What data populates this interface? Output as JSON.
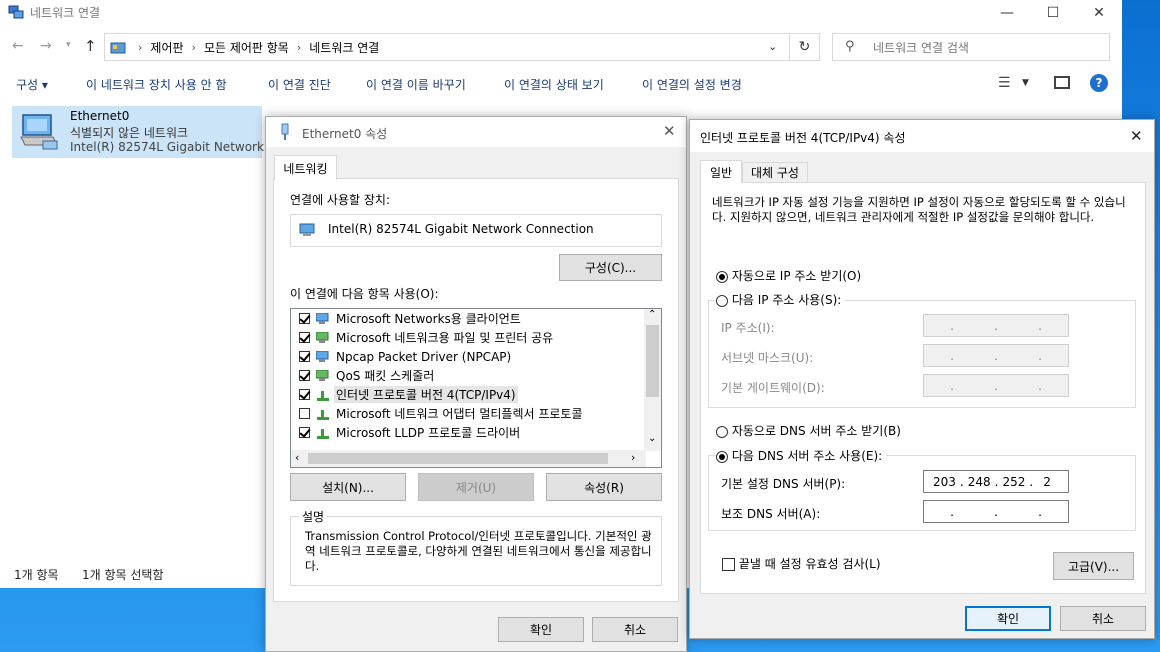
{
  "explorer": {
    "title": "네트워크 연결",
    "breadcrumb": [
      "제어판",
      "모든 제어판 항목",
      "네트워크 연결"
    ],
    "search_placeholder": "네트워크 연결 검색",
    "commands": [
      "구성 ▾",
      "이 네트워크 장치 사용 안 함",
      "이 연결 진단",
      "이 연결 이름 바꾸기",
      "이 연결의 상태 보기",
      "이 연결의 설정 변경"
    ],
    "item": {
      "name": "Ethernet0",
      "status": "식별되지 않은 네트워크",
      "device": "Intel(R) 82574L Gigabit Network ..."
    },
    "status_count": "1개 항목",
    "status_selected": "1개 항목 선택함"
  },
  "eth_dialog": {
    "title": "Ethernet0 속성",
    "tab": "네트워킹",
    "connect_using_label": "연결에 사용할 장치:",
    "device_name": "Intel(R) 82574L Gigabit Network Connection",
    "configure_button": "구성(C)...",
    "items_label": "이 연결에 다음 항목 사용(O):",
    "items": [
      {
        "label": "Microsoft Networks용 클라이언트",
        "checked": true,
        "icon": "network-client-icon"
      },
      {
        "label": "Microsoft 네트워크용 파일 및 프린터 공유",
        "checked": true,
        "icon": "network-service-icon"
      },
      {
        "label": "Npcap Packet Driver (NPCAP)",
        "checked": true,
        "icon": "network-client-icon"
      },
      {
        "label": "QoS 패킷 스케줄러",
        "checked": true,
        "icon": "network-service-icon"
      },
      {
        "label": "인터넷 프로토콜 버전 4(TCP/IPv4)",
        "checked": true,
        "icon": "protocol-icon",
        "selected": true
      },
      {
        "label": "Microsoft 네트워크 어댑터 멀티플렉서 프로토콜",
        "checked": false,
        "icon": "protocol-icon"
      },
      {
        "label": "Microsoft LLDP 프로토콜 드라이버",
        "checked": true,
        "icon": "protocol-icon"
      }
    ],
    "install_button": "설치(N)...",
    "uninstall_button": "제거(U)",
    "properties_button": "속성(R)",
    "description_title": "설명",
    "description": "Transmission Control Protocol/인터넷 프로토콜입니다. 기본적인 광역 네트워크 프로토콜로, 다양하게 연결된 네트워크에서 통신을 제공합니다.",
    "ok_button": "확인",
    "cancel_button": "취소"
  },
  "ipv4_dialog": {
    "title": "인터넷 프로토콜 버전 4(TCP/IPv4) 속성",
    "tab_general": "일반",
    "tab_alternate": "대체 구성",
    "intro": "네트워크가 IP 자동 설정 기능을 지원하면 IP 설정이 자동으로 할당되도록 할 수 있습니다. 지원하지 않으면, 네트워크 관리자에게 적절한 IP 설정값을 문의해야 합니다.",
    "auto_ip": "자동으로 IP 주소 받기(O)",
    "manual_ip": "다음 IP 주소 사용(S):",
    "ip_label": "IP 주소(I):",
    "mask_label": "서브넷 마스크(U):",
    "gateway_label": "기본 게이트웨이(D):",
    "auto_dns": "자동으로 DNS 서버 주소 받기(B)",
    "manual_dns": "다음 DNS 서버 주소 사용(E):",
    "preferred_dns_label": "기본 설정 DNS 서버(P):",
    "preferred_dns": [
      "203",
      "248",
      "252",
      "2"
    ],
    "alternate_dns_label": "보조 DNS 서버(A):",
    "validate_label": "끝낼 때 설정 유효성 검사(L)",
    "advanced_button": "고급(V)...",
    "ok_button": "확인",
    "cancel_button": "취소"
  }
}
